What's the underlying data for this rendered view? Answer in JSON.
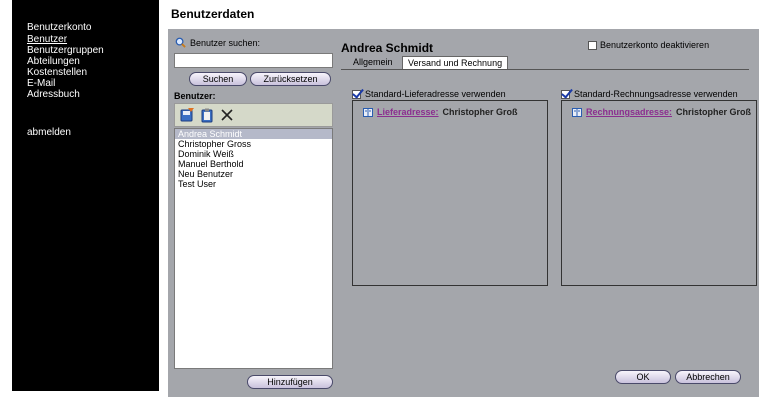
{
  "sidebar": {
    "items": [
      {
        "label": "Benutzerkonto",
        "active": false
      },
      {
        "label": "Benutzer",
        "active": true
      },
      {
        "label": "Benutzergruppen",
        "active": false
      },
      {
        "label": "Abteilungen",
        "active": false
      },
      {
        "label": "Kostenstellen",
        "active": false
      },
      {
        "label": "E-Mail",
        "active": false
      },
      {
        "label": "Adressbuch",
        "active": false
      }
    ],
    "logout_label": "abmelden"
  },
  "page_title": "Benutzerdaten",
  "search": {
    "label": "Benutzer suchen:",
    "value": "",
    "placeholder": "",
    "search_button": "Suchen",
    "reset_button": "Zurücksetzen"
  },
  "users": {
    "label": "Benutzer:",
    "list": [
      "Andrea Schmidt",
      "Christopher Gross",
      "Dominik Weiß",
      "Manuel Berthold",
      "Neu Benutzer",
      "Test User"
    ],
    "selected_index": 0,
    "add_button": "Hinzufügen",
    "toolbar_icons": [
      "save-icon",
      "clipboard-icon",
      "delete-icon"
    ]
  },
  "detail": {
    "name": "Andrea Schmidt",
    "deactivate_label": "Benutzerkonto deaktivieren",
    "deactivate_checked": false,
    "tabs": [
      {
        "label": "Allgemein",
        "active": false
      },
      {
        "label": "Versand und Rechnung",
        "active": true
      }
    ],
    "shipping": {
      "checkbox_label": "Standard-Lieferadresse verwenden",
      "checked": true,
      "link_label": "Lieferadresse:",
      "name": "Christopher Groß"
    },
    "billing": {
      "checkbox_label": "Standard-Rechnungsadresse verwenden",
      "checked": true,
      "link_label": "Rechnungsadresse:",
      "name": "Christopher Groß"
    },
    "ok_button": "OK",
    "cancel_button": "Abbrechen"
  },
  "colors": {
    "sidebar_bg": "#000000",
    "content_bg": "#a4a6ab",
    "link": "#8b2e8f",
    "selected_row": "#b5b9c9"
  }
}
